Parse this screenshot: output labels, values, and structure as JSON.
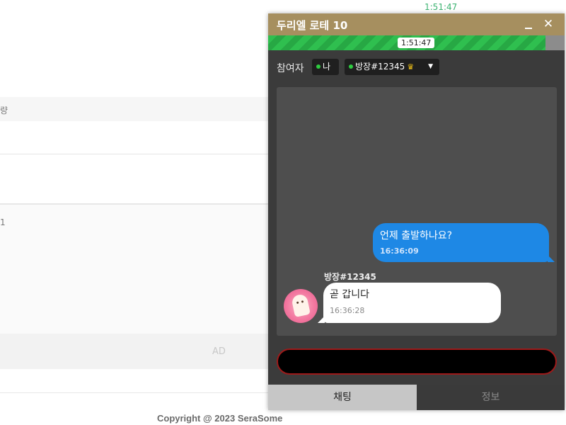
{
  "background": {
    "time": "1:51:47",
    "fragment1": "량",
    "fragment2": "1",
    "ad_label": "AD",
    "copyright": "Copyright @ 2023 SeraSome"
  },
  "chat_window": {
    "title": "두리엘 로테 10",
    "minimize_icon": "minimize-icon",
    "close_icon": "close-icon",
    "close_glyph": "✕",
    "timer": {
      "label": "1:51:47",
      "progress_fraction": 0.935
    },
    "participants": {
      "label": "참여자",
      "me": "나",
      "host": "방장#12345",
      "host_icon": "crown-icon",
      "crown_glyph": "♛",
      "caret_glyph": "▼"
    },
    "messages": [
      {
        "direction": "outgoing",
        "text": "언제 출발하나요?",
        "time": "16:36:09"
      },
      {
        "direction": "incoming",
        "sender": "방장#12345",
        "text": "곧 갑니다",
        "time": "16:36:28"
      }
    ],
    "input": {
      "value": "",
      "placeholder": ""
    },
    "tabs": [
      {
        "label": "채팅",
        "active": true
      },
      {
        "label": "정보",
        "active": false
      }
    ],
    "colors": {
      "titlebar": "#a68f5f",
      "timer_green": "#2fbf4f",
      "outgoing_bubble": "#1e88e5",
      "input_border": "#9e1a1a",
      "online_dot": "#2ecc40"
    }
  }
}
